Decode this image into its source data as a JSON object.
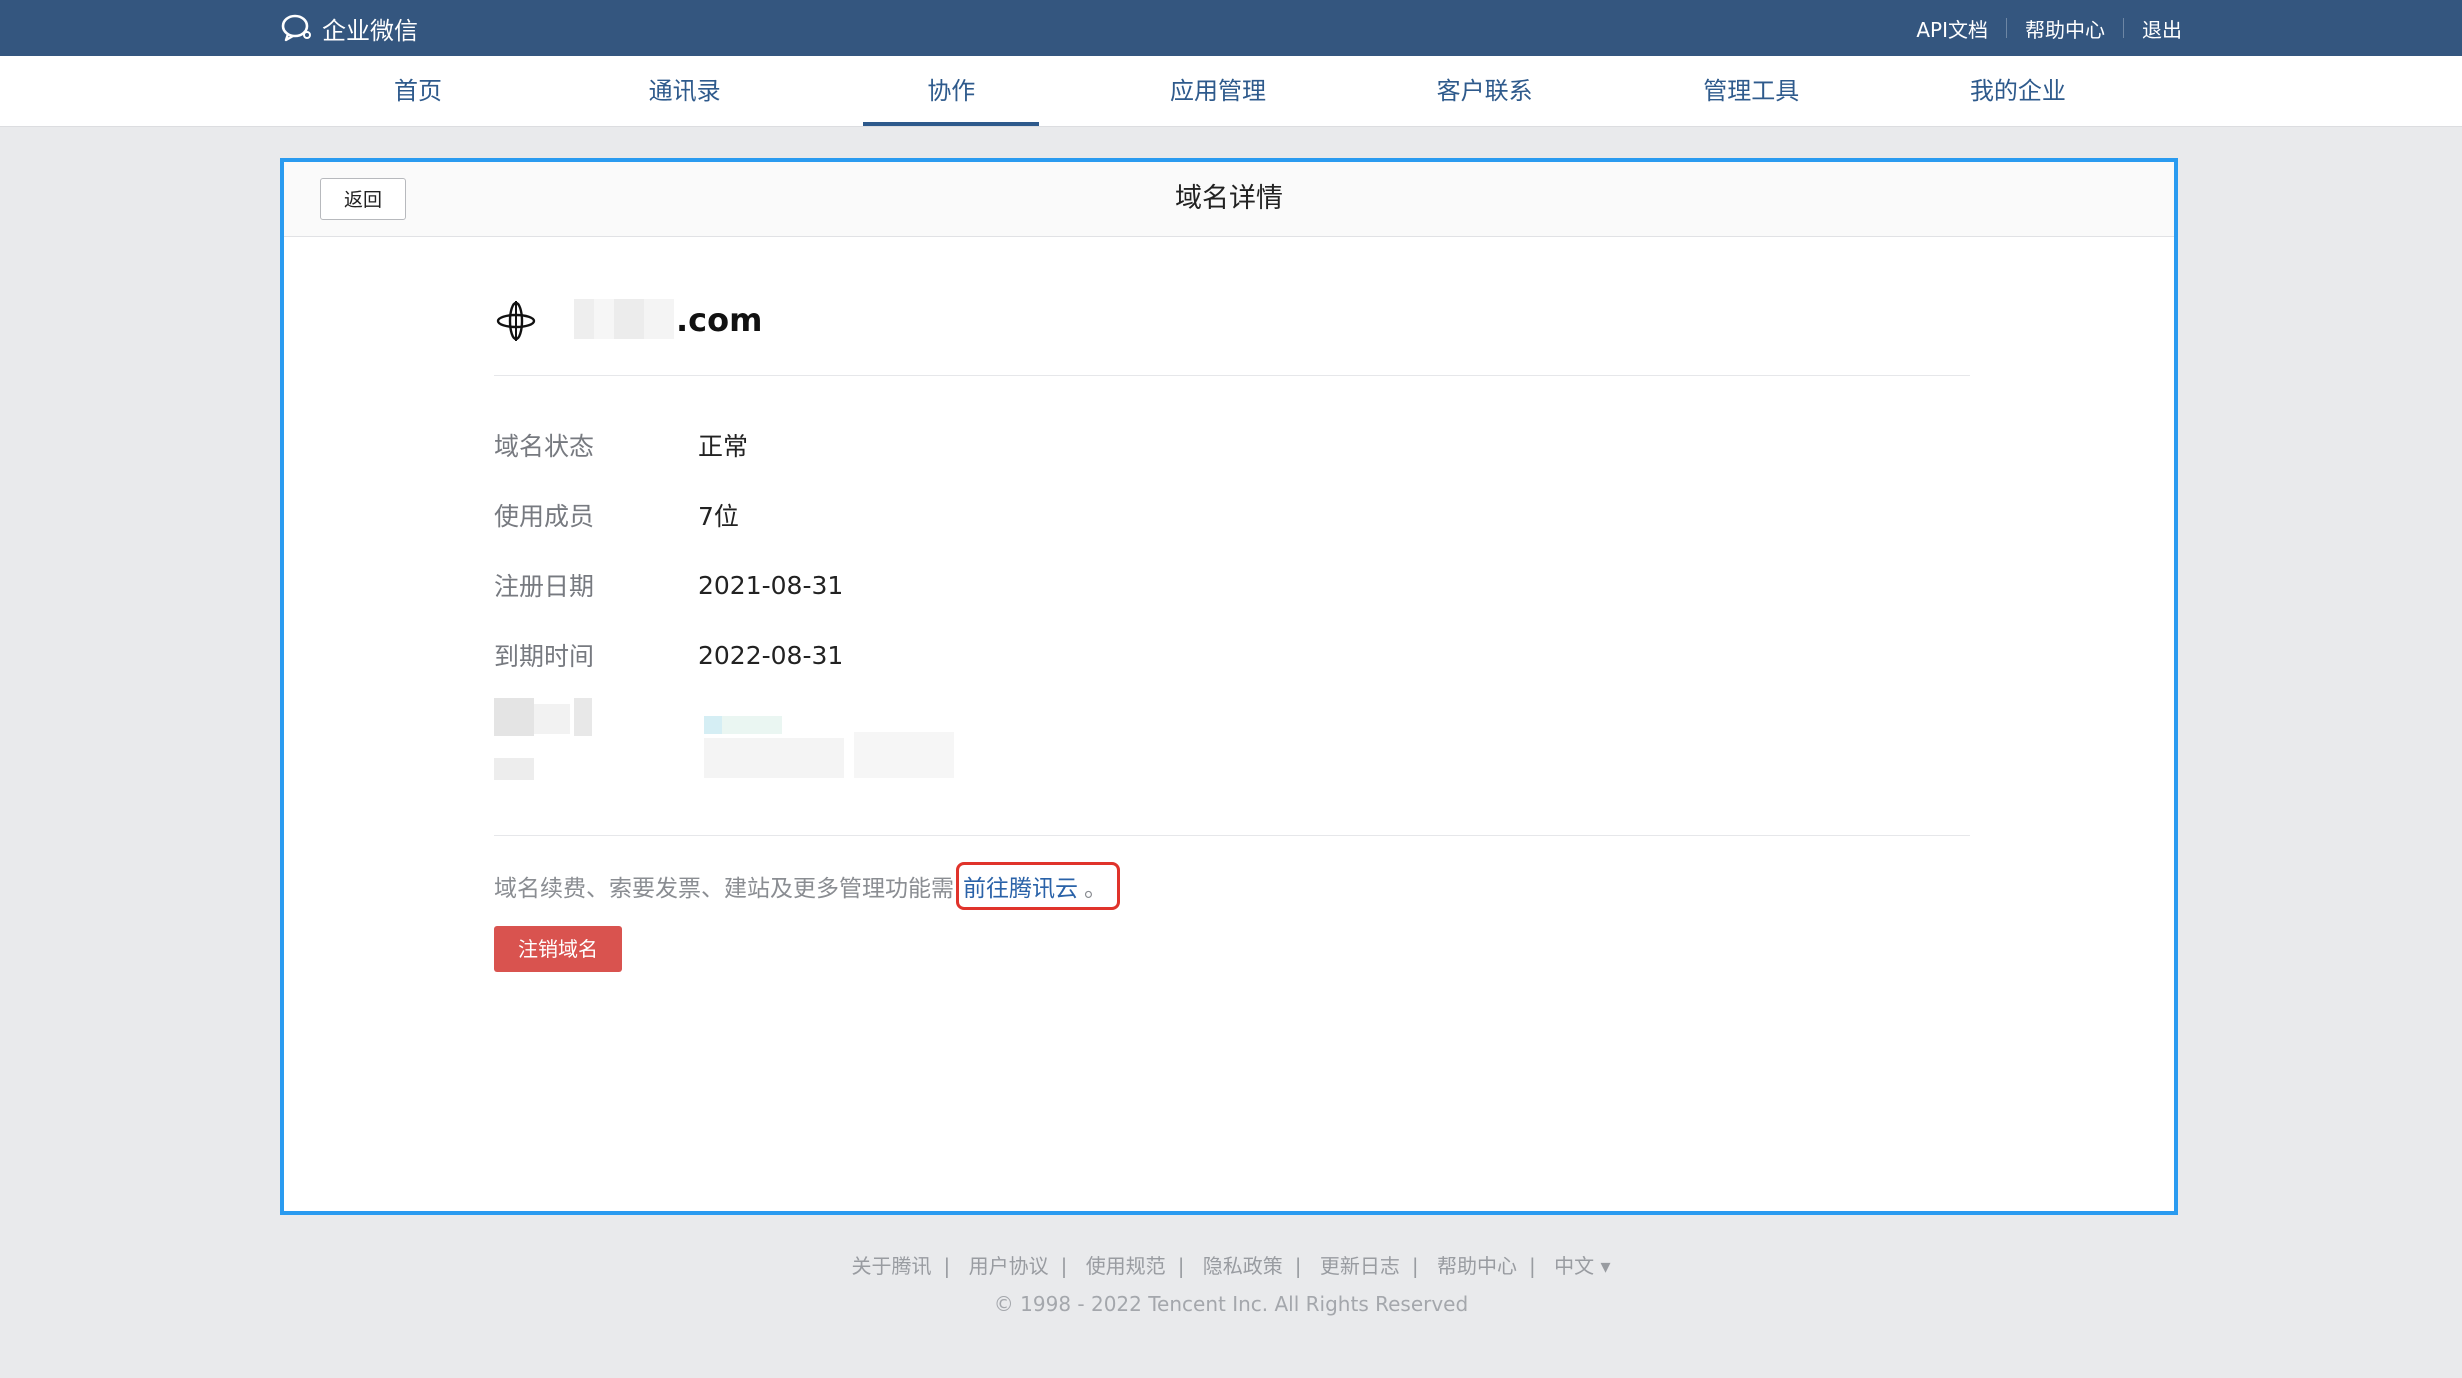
{
  "topbar": {
    "brand": "企业微信",
    "links": [
      "API文档",
      "帮助中心",
      "退出"
    ]
  },
  "nav": {
    "items": [
      "首页",
      "通讯录",
      "协作",
      "应用管理",
      "客户联系",
      "管理工具",
      "我的企业"
    ],
    "active": "协作"
  },
  "card": {
    "back_label": "返回",
    "title": "域名详情",
    "domain_suffix": ".com",
    "info": [
      {
        "label": "域名状态",
        "value": "正常"
      },
      {
        "label": "使用成员",
        "value": "7位"
      },
      {
        "label": "注册日期",
        "value": "2021-08-31"
      },
      {
        "label": "到期时间",
        "value": "2022-08-31"
      }
    ],
    "hint_text": "域名续费、索要发票、建站及更多管理功能需",
    "hint_link": "前往腾讯云",
    "hint_end": "。",
    "cancel_label": "注销域名"
  },
  "footer": {
    "links": [
      "关于腾讯",
      "用户协议",
      "使用规范",
      "隐私政策",
      "更新日志",
      "帮助中心",
      "中文 ▾"
    ],
    "copyright": "© 1998 - 2022 Tencent Inc. All Rights Reserved"
  },
  "colors": {
    "topbar": "#34567f",
    "nav_text": "#2e5a8c",
    "highlight_border": "#2a9bf0",
    "annotation_red": "#e0332b",
    "danger": "#d9534f",
    "link": "#2a62a8"
  }
}
